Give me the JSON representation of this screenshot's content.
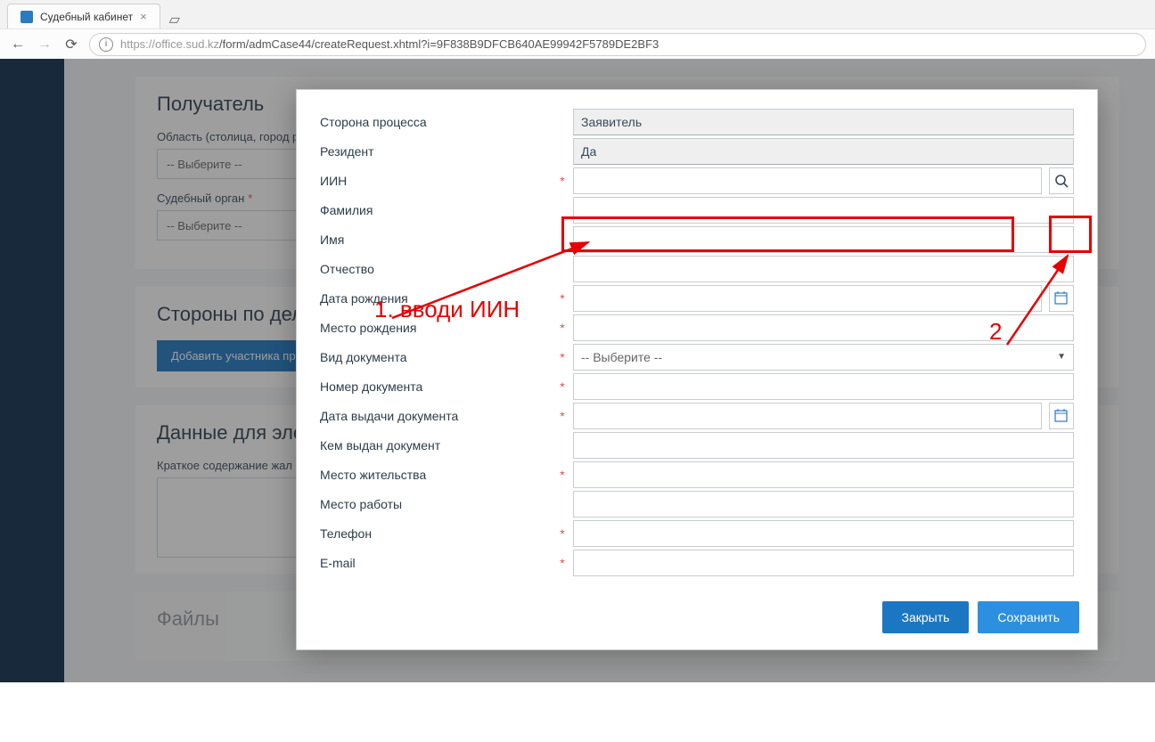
{
  "browser": {
    "tab_title": "Судебный кабинет",
    "url_host": "https://office.sud.kz",
    "url_path": "/form/admCase44/createRequest.xhtml?i=9F838B9DFCB640AE99942F5789DE2BF3"
  },
  "background": {
    "recipient_title": "Получатель",
    "region_label": "Область (столица, город р",
    "select_placeholder": "-- Выберите --",
    "court_label": "Судебный орган",
    "parties_title": "Стороны по делу",
    "add_participant": "Добавить участника пр",
    "electronic_title": "Данные для элек",
    "brief_label": "Краткое содержание жал",
    "files_title": "Файлы"
  },
  "modal": {
    "labels": {
      "side": "Сторона процесса",
      "resident": "Резидент",
      "iin": "ИИН",
      "surname": "Фамилия",
      "name": "Имя",
      "patronymic": "Отчество",
      "birthdate": "Дата рождения",
      "birthplace": "Место рождения",
      "doctype": "Вид документа",
      "docnum": "Номер документа",
      "docdate": "Дата выдачи документа",
      "docissuer": "Кем выдан документ",
      "address": "Место жительства",
      "workplace": "Место работы",
      "phone": "Телефон",
      "email": "E-mail"
    },
    "values": {
      "side": "Заявитель",
      "resident": "Да",
      "doctype_placeholder": "-- Выберите --"
    },
    "buttons": {
      "close": "Закрыть",
      "save": "Сохранить"
    }
  },
  "annotations": {
    "text1": "1. вводи ИИН",
    "text2": "2"
  }
}
